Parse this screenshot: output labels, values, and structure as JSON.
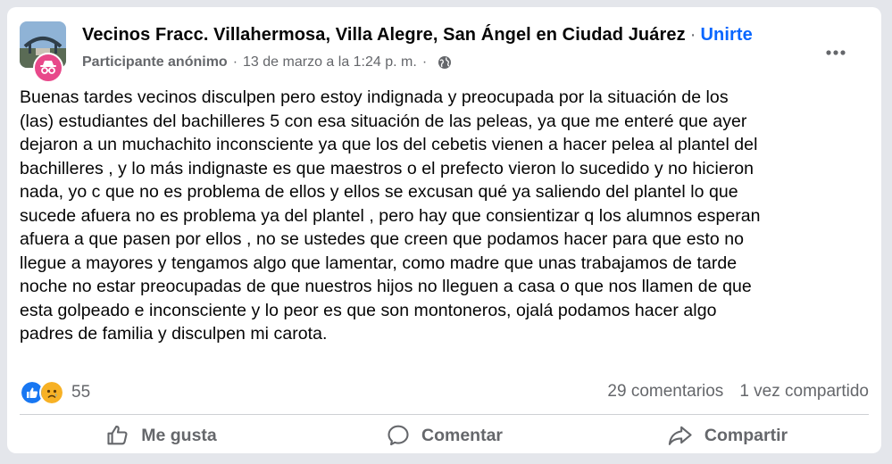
{
  "post": {
    "group_name": "Vecinos Fracc. Villahermosa, Villa Alegre, San Ángel en Ciudad Juárez",
    "separator": "·",
    "join_label": "Unirte",
    "author": "Participante anónimo",
    "timestamp": "13 de marzo a la 1:24 p. m.",
    "privacy_icon": "globe-icon",
    "more_icon": "more-options-icon",
    "body_lines": [
      "Buenas tardes vecinos disculpen pero estoy indignada y preocupada por la situación de los",
      "(las) estudiantes del bachilleres 5 con esa situación de las peleas, ya que me enteré que ayer",
      "dejaron a un muchachito inconsciente ya que los del cebetis vienen a hacer pelea al plantel del",
      "bachilleres , y lo más indignaste es que maestros o el prefecto vieron lo sucedido y no hicieron",
      "nada, yo c que no es problema de ellos y ellos se excusan qué ya saliendo del plantel lo que",
      "sucede afuera no es problema ya del plantel , pero hay que consientizar q los alumnos esperan",
      "afuera a que pasen por ellos , no se ustedes que creen que podamos hacer para que esto no",
      "llegue a mayores y tengamos algo que lamentar, como madre que unas trabajamos de tarde",
      "noche no estar preocupadas de que nuestros hijos  no lleguen a casa o que nos llamen de que",
      "esta golpeado e inconsciente y lo peor es que son montoneros, ojalá podamos hacer algo",
      "padres de familia y disculpen mi carota."
    ]
  },
  "stats": {
    "reactions": [
      "like-reaction-icon",
      "sad-reaction-icon"
    ],
    "reaction_count": "55",
    "comments": "29 comentarios",
    "shares": "1 vez compartido"
  },
  "actions": {
    "like": {
      "label": "Me gusta",
      "icon": "thumbs-up-icon"
    },
    "comment": {
      "label": "Comentar",
      "icon": "comment-bubble-icon"
    },
    "share": {
      "label": "Compartir",
      "icon": "share-arrow-icon"
    }
  },
  "colors": {
    "accent": "#0866ff",
    "secondary_text": "#65676b",
    "anonymous_badge": "#e8488a",
    "sad_reaction": "#f7b125"
  }
}
